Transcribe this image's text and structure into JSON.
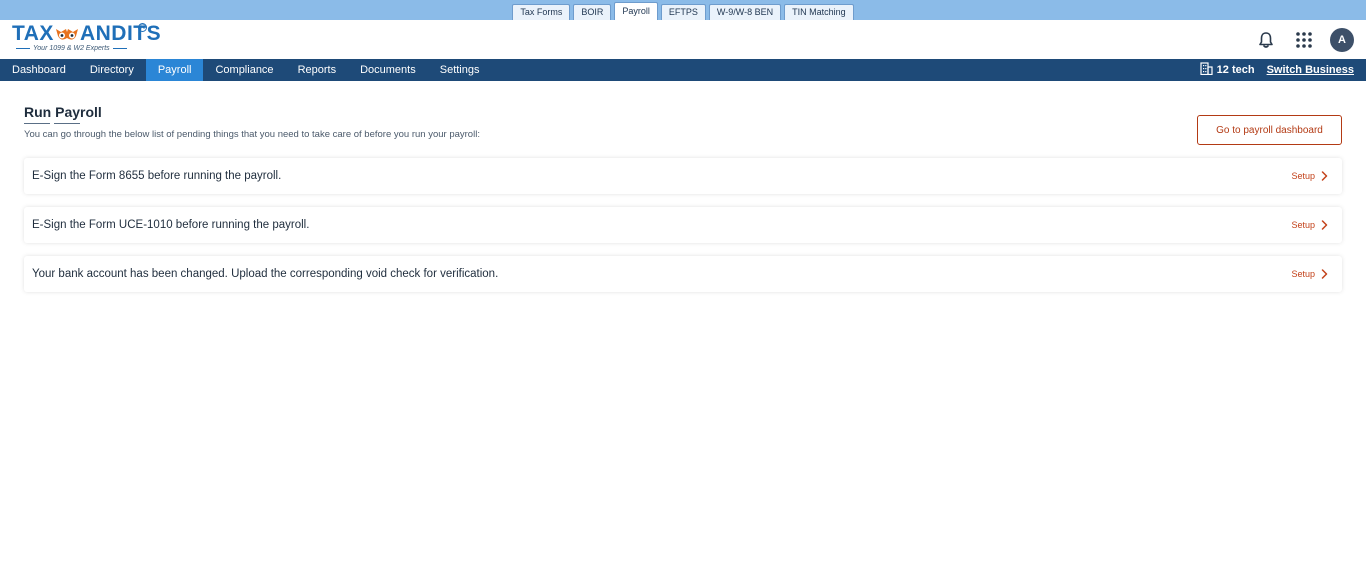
{
  "product_tabs": [
    {
      "label": "Tax Forms",
      "active": false
    },
    {
      "label": "BOIR",
      "active": false
    },
    {
      "label": "Payroll",
      "active": true
    },
    {
      "label": "EFTPS",
      "active": false
    },
    {
      "label": "W-9/W-8 BEN",
      "active": false
    },
    {
      "label": "TIN Matching",
      "active": false
    }
  ],
  "logo": {
    "left": "TAX",
    "right": "ANDITS",
    "tagline": "Your 1099 & W2 Experts",
    "registered": "R"
  },
  "header": {
    "avatar_initial": "A",
    "icons": [
      "bell-icon",
      "apps-grid-icon"
    ]
  },
  "nav": {
    "items": [
      {
        "label": "Dashboard",
        "active": false
      },
      {
        "label": "Directory",
        "active": false
      },
      {
        "label": "Payroll",
        "active": true
      },
      {
        "label": "Compliance",
        "active": false
      },
      {
        "label": "Reports",
        "active": false
      },
      {
        "label": "Documents",
        "active": false
      },
      {
        "label": "Settings",
        "active": false
      }
    ],
    "business_name": "12 tech",
    "switch_business": "Switch Business"
  },
  "main": {
    "title": "Run Payroll",
    "subtitle": "You can go through the below list of pending things that you need to take care of before you run your payroll:",
    "go_button": "Go to payroll dashboard",
    "tasks": [
      {
        "text": "E-Sign the Form 8655 before running the payroll.",
        "action": "Setup"
      },
      {
        "text": "E-Sign the Form UCE-1010 before running the payroll.",
        "action": "Setup"
      },
      {
        "text": "Your bank account has been changed. Upload the corresponding void check for verification.",
        "action": "Setup"
      }
    ]
  },
  "colors": {
    "product_bar": "#8bbbe8",
    "nav_bg": "#1e4a78",
    "nav_active": "#2b86d6",
    "accent_orange": "#c3421a",
    "brand_blue": "#1f6fb8"
  }
}
